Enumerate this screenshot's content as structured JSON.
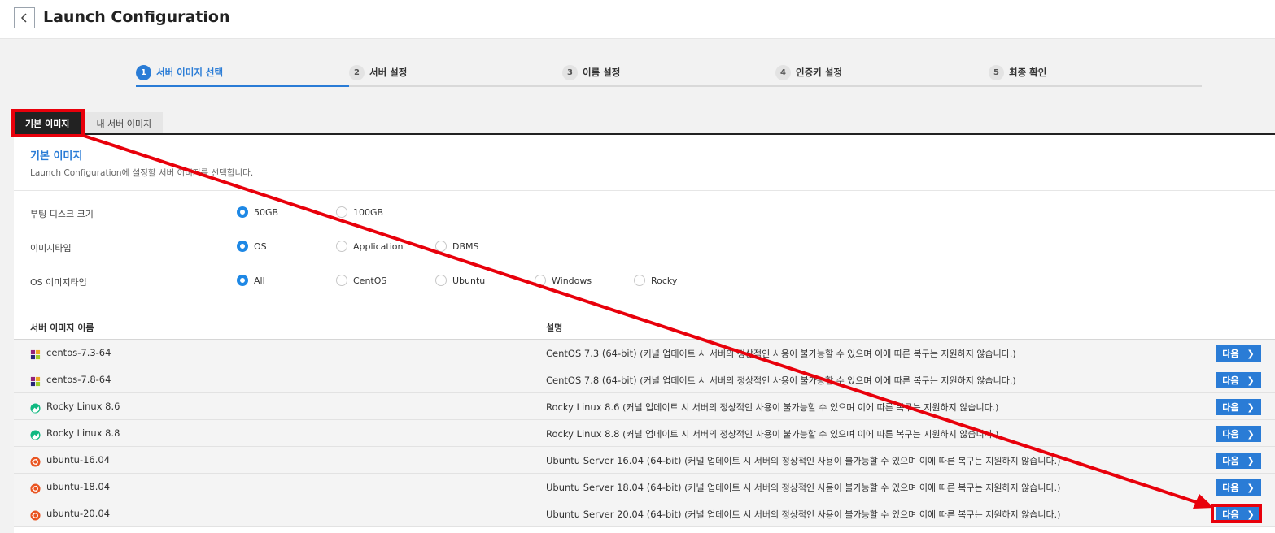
{
  "header": {
    "title": "Launch Configuration"
  },
  "steps": [
    {
      "num": "1",
      "label": "서버 이미지 선택"
    },
    {
      "num": "2",
      "label": "서버 설정"
    },
    {
      "num": "3",
      "label": "이름 설정"
    },
    {
      "num": "4",
      "label": "인증키 설정"
    },
    {
      "num": "5",
      "label": "최종 확인"
    }
  ],
  "tabs": [
    {
      "label": "기본 이미지"
    },
    {
      "label": "내 서버 이미지"
    }
  ],
  "section": {
    "title": "기본 이미지",
    "description": "Launch Configuration에 설정할 서버 이미지를 선택합니다."
  },
  "options": {
    "boot_disk": {
      "label": "부팅 디스크 크기",
      "choices": [
        "50GB",
        "100GB"
      ],
      "selected": "50GB"
    },
    "image_type": {
      "label": "이미지타입",
      "choices": [
        "OS",
        "Application",
        "DBMS"
      ],
      "selected": "OS"
    },
    "os_image_type": {
      "label": "OS 이미지타입",
      "choices": [
        "All",
        "CentOS",
        "Ubuntu",
        "Windows",
        "Rocky"
      ],
      "selected": "All"
    }
  },
  "table": {
    "headers": {
      "name": "서버 이미지 이름",
      "desc": "설명"
    },
    "rows": [
      {
        "icon": "centos-icon",
        "name": "centos-7.3-64",
        "desc": "CentOS 7.3 (64-bit)",
        "note": "(커널 업데이트 시 서버의 정상적인 사용이 불가능할 수 있으며 이에 따른 복구는 지원하지 않습니다.)",
        "button": "다음"
      },
      {
        "icon": "centos-icon",
        "name": "centos-7.8-64",
        "desc": "CentOS 7.8 (64-bit)",
        "note": "(커널 업데이트 시 서버의 정상적인 사용이 불가능할 수 있으며 이에 따른 복구는 지원하지 않습니다.)",
        "button": "다음"
      },
      {
        "icon": "rocky-icon",
        "name": "Rocky Linux 8.6",
        "desc": "Rocky Linux 8.6",
        "note": "(커널 업데이트 시 서버의 정상적인 사용이 불가능할 수 있으며 이에 따른 복구는 지원하지 않습니다.)",
        "button": "다음"
      },
      {
        "icon": "rocky-icon",
        "name": "Rocky Linux 8.8",
        "desc": "Rocky Linux 8.8",
        "note": "(커널 업데이트 시 서버의 정상적인 사용이 불가능할 수 있으며 이에 따른 복구는 지원하지 않습니다.)",
        "button": "다음"
      },
      {
        "icon": "ubuntu-icon",
        "name": "ubuntu-16.04",
        "desc": "Ubuntu Server 16.04 (64-bit)",
        "note": "(커널 업데이트 시 서버의 정상적인 사용이 불가능할 수 있으며 이에 따른 복구는 지원하지 않습니다.)",
        "button": "다음"
      },
      {
        "icon": "ubuntu-icon",
        "name": "ubuntu-18.04",
        "desc": "Ubuntu Server 18.04 (64-bit)",
        "note": "(커널 업데이트 시 서버의 정상적인 사용이 불가능할 수 있으며 이에 따른 복구는 지원하지 않습니다.)",
        "button": "다음"
      },
      {
        "icon": "ubuntu-icon",
        "name": "ubuntu-20.04",
        "desc": "Ubuntu Server 20.04 (64-bit)",
        "note": "(커널 업데이트 시 서버의 정상적인 사용이 불가능할 수 있으며 이에 따른 복구는 지원하지 않습니다.)",
        "button": "다음"
      }
    ]
  },
  "colors": {
    "accent": "#2a7cd6",
    "highlight": "#e8000b",
    "tab_active": "#222222"
  }
}
